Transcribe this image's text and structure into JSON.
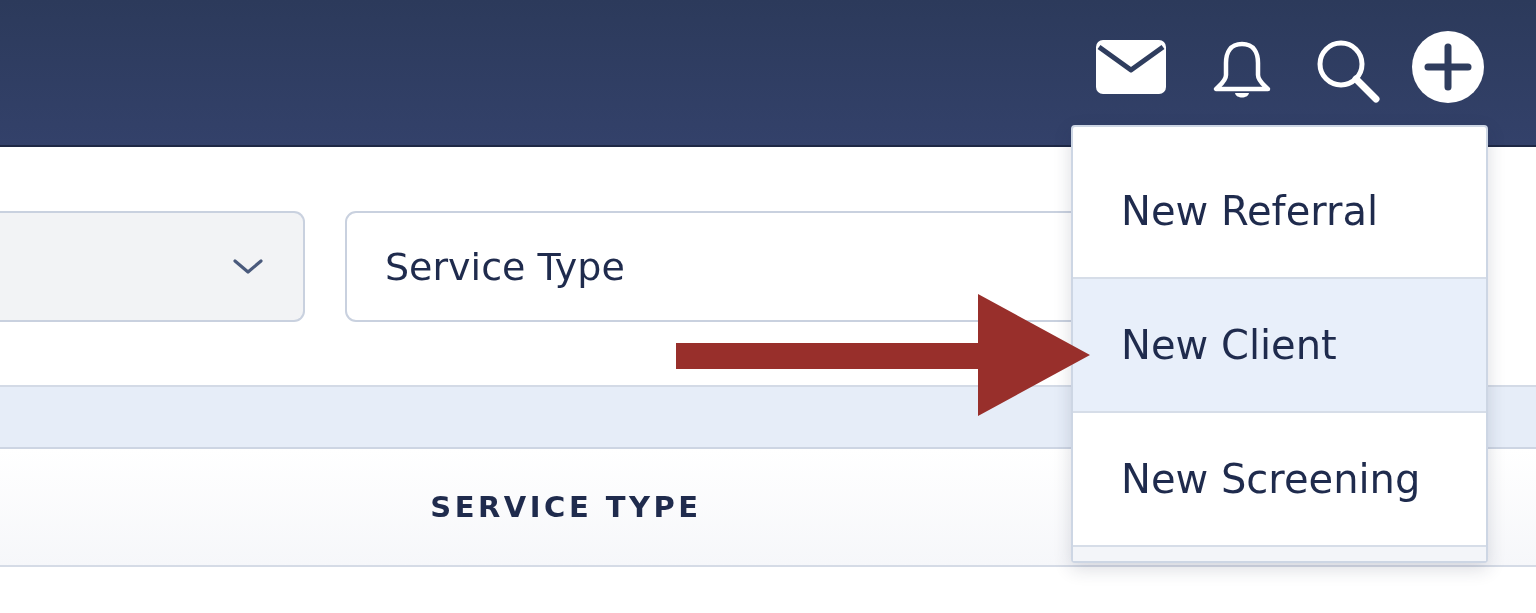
{
  "header": {
    "actions": [
      {
        "kind": "mail"
      },
      {
        "kind": "bell"
      },
      {
        "kind": "search"
      },
      {
        "kind": "add"
      }
    ]
  },
  "filters": [
    {
      "kind": "select"
    },
    {
      "kind": "text",
      "placeholder": "Service Type"
    }
  ],
  "table": {
    "columns": [
      {
        "label": "SERVICE TYPE"
      }
    ]
  },
  "add_menu": {
    "items": [
      {
        "label": "New Referral",
        "selected": false
      },
      {
        "label": "New Client",
        "selected": true
      },
      {
        "label": "New Screening",
        "selected": false
      }
    ]
  },
  "annotation": {
    "kind": "arrow"
  }
}
